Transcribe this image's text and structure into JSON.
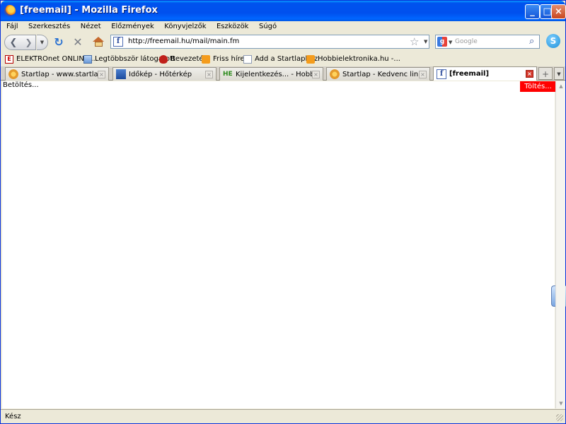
{
  "window": {
    "title": "[freemail] - Mozilla Firefox"
  },
  "menu": {
    "items": [
      "Fájl",
      "Szerkesztés",
      "Nézet",
      "Előzmények",
      "Könyvjelzők",
      "Eszközök",
      "Súgó"
    ]
  },
  "nav": {
    "url": "http://freemail.hu/mail/main.fm",
    "search_placeholder": "Google"
  },
  "bookmarks": [
    {
      "label": "ELEKTROnet ONLINE ...",
      "icon": "elektronet-icon"
    },
    {
      "label": "Legtöbbször látogatott",
      "icon": "folder-icon"
    },
    {
      "label": "Bevezetés",
      "icon": "red-hat-icon"
    },
    {
      "label": "Friss hírek",
      "icon": "rss-icon"
    },
    {
      "label": "Add a Startlaphoz",
      "icon": "page-icon"
    },
    {
      "label": "Hobbielektronika.hu -...",
      "icon": "rss-icon"
    }
  ],
  "tabs": [
    {
      "label": "Startlap - www.startlap.hu...",
      "icon": "startlap-icon",
      "active": false
    },
    {
      "label": "Időkép - Hőtérkép",
      "icon": "idokep-icon",
      "active": false
    },
    {
      "label": "Kijelentkezés... - Hobbiele...",
      "icon": "hobbielektronika-icon",
      "active": false
    },
    {
      "label": "Startlap - Kedvenc linkek",
      "icon": "startlap-icon",
      "active": false
    },
    {
      "label": "[freemail]",
      "icon": "freemail-icon",
      "active": true
    }
  ],
  "icons": {
    "he_text": "HE",
    "freemail_glyph": "f",
    "elektro_glyph": "E"
  },
  "content": {
    "loading_text": "Betöltés...",
    "loading_badge": "Töltés..."
  },
  "status": {
    "text": "Kész"
  },
  "colors": {
    "loading_badge": "#ff0000",
    "titlebar": "#0054e3"
  }
}
